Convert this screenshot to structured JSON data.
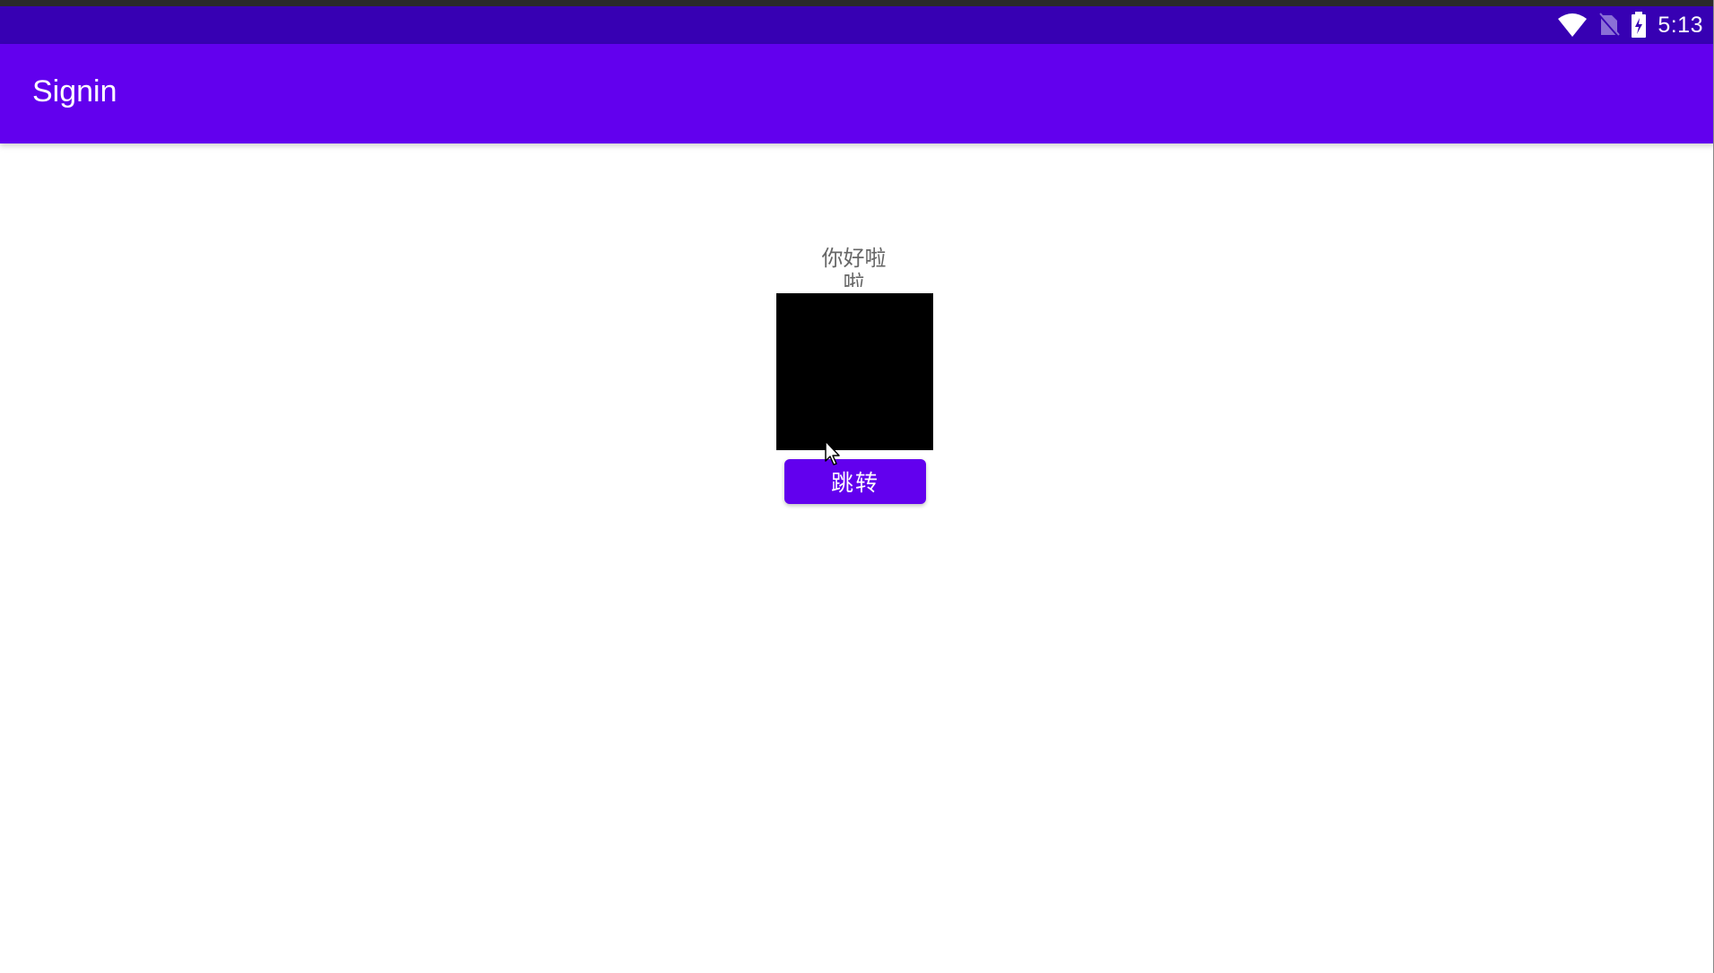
{
  "status_bar": {
    "time": "5:13",
    "icons": [
      "wifi-icon",
      "no-sim-icon",
      "battery-charging-icon"
    ]
  },
  "app_bar": {
    "title": "Signin"
  },
  "main": {
    "greeting": "你好啦啦",
    "button_label": "跳转"
  },
  "colors": {
    "primary": "#6200ee",
    "primary_dark": "#3700b3",
    "text_secondary": "#666666",
    "image_placeholder": "#000000"
  }
}
